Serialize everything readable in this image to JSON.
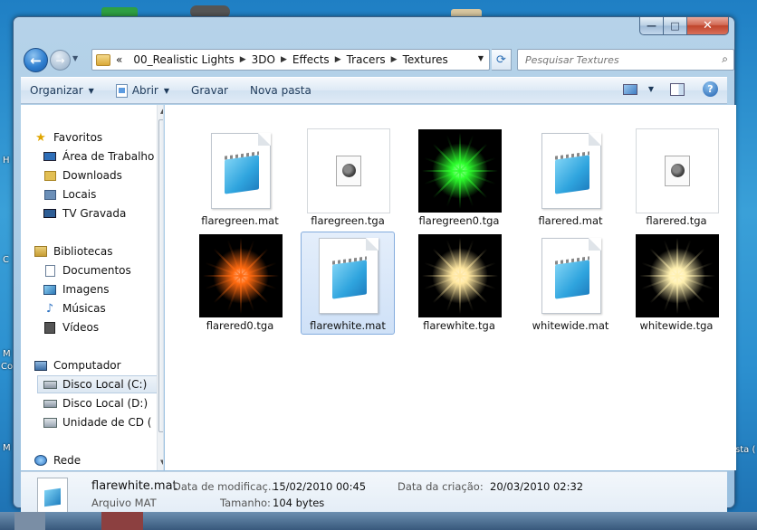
{
  "window": {
    "caption": {
      "minimize": "—",
      "maximize": "□",
      "close": "✕"
    }
  },
  "nav": {
    "back_glyph": "←",
    "forward_glyph": "→",
    "breadcrumb_prefix": "«",
    "breadcrumb": [
      "00_Realistic Lights",
      "3DO",
      "Effects",
      "Tracers",
      "Textures"
    ],
    "search_placeholder": "Pesquisar Textures"
  },
  "toolbar": {
    "organize": "Organizar",
    "open": "Abrir",
    "burn": "Gravar",
    "new_folder": "Nova pasta"
  },
  "sidebar": {
    "favorites_header": "Favoritos",
    "favorites": [
      {
        "label": "Área de Trabalho",
        "icon": "desktop-icon"
      },
      {
        "label": "Downloads",
        "icon": "downloads-icon"
      },
      {
        "label": "Locais",
        "icon": "places-icon"
      },
      {
        "label": "TV Gravada",
        "icon": "tv-icon"
      }
    ],
    "libraries_header": "Bibliotecas",
    "libraries": [
      {
        "label": "Documentos",
        "icon": "documents-icon"
      },
      {
        "label": "Imagens",
        "icon": "images-icon"
      },
      {
        "label": "Músicas",
        "icon": "music-icon"
      },
      {
        "label": "Vídeos",
        "icon": "videos-icon"
      }
    ],
    "computer_header": "Computador",
    "drives": [
      {
        "label": "Disco Local (C:)",
        "icon": "drive-icon",
        "selected": true
      },
      {
        "label": "Disco Local (D:)",
        "icon": "drive-icon",
        "selected": false
      },
      {
        "label": "Unidade de CD (",
        "icon": "cd-drive-icon",
        "selected": false
      }
    ],
    "network_header": "Rede"
  },
  "files": [
    {
      "name": "flaregreen.mat",
      "kind": "mat"
    },
    {
      "name": "flaregreen.tga",
      "kind": "gimp"
    },
    {
      "name": "flaregreen0.tga",
      "kind": "flare",
      "color": "#2dff2d"
    },
    {
      "name": "flarered.mat",
      "kind": "mat"
    },
    {
      "name": "flarered.tga",
      "kind": "gimp"
    },
    {
      "name": "flarered0.tga",
      "kind": "flare",
      "color": "#ff6a10"
    },
    {
      "name": "flarewhite.mat",
      "kind": "mat",
      "selected": true
    },
    {
      "name": "flarewhite.tga",
      "kind": "flare",
      "color": "#ffe7a0"
    },
    {
      "name": "whitewide.mat",
      "kind": "mat"
    },
    {
      "name": "whitewide.tga",
      "kind": "flare",
      "color": "#fff0b0"
    }
  ],
  "details": {
    "name": "flarewhite.mat",
    "type": "Arquivo MAT",
    "modified_label": "Data de modificaç...",
    "modified_value": "15/02/2010 00:45",
    "size_label": "Tamanho:",
    "size_value": "104 bytes",
    "created_label": "Data da criação:",
    "created_value": "20/03/2010 02:32"
  },
  "desktop": {
    "edge_texts": [
      "H",
      "C",
      "M",
      "Co",
      "M",
      "sta ("
    ]
  }
}
